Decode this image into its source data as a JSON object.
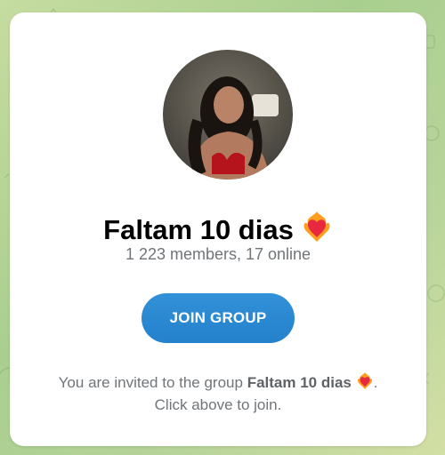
{
  "group": {
    "title": "Faltam 10 dias",
    "members_text": "1 223 members, 17 online",
    "title_emoji": "heart-on-fire-icon"
  },
  "join_button": {
    "label": "JOIN GROUP"
  },
  "invite": {
    "prefix": "You are invited to the group",
    "group_name": "Faltam 10 dias",
    "suffix": ".",
    "line2": "Click above to join."
  },
  "colors": {
    "accent": "#2481cc",
    "background": "#b7d49a",
    "secondary_text": "#707579"
  }
}
